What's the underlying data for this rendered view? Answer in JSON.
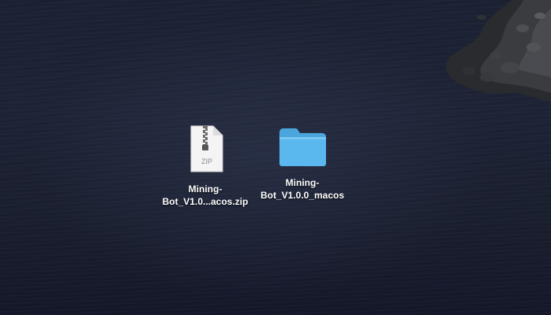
{
  "desktop": {
    "background": "dark-ocean-rocks-wallpaper",
    "items": [
      {
        "type": "zip-archive",
        "icon": "zip-file-icon",
        "icon_badge": "ZIP",
        "label_line1": "Mining-",
        "label_line2": "Bot_V1.0...acos.zip"
      },
      {
        "type": "folder",
        "icon": "folder-icon",
        "label_line1": "Mining-",
        "label_line2": "Bot_V1.0.0_macos"
      }
    ]
  },
  "colors": {
    "folder_blue": "#5bb8ee",
    "folder_tab": "#4aa6dd",
    "document_white": "#f4f4f4",
    "label_text": "#ffffff"
  }
}
